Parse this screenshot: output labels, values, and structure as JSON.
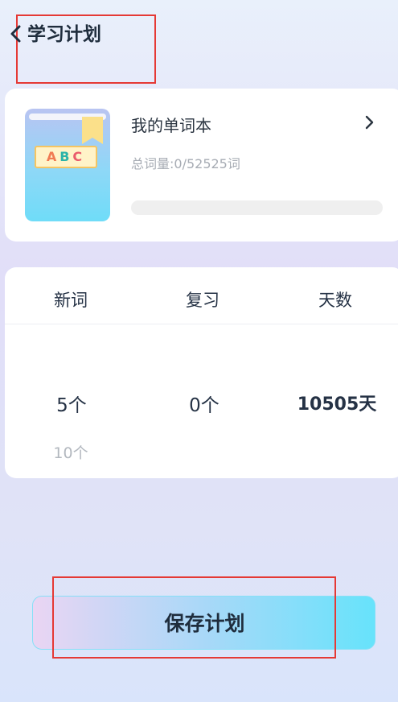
{
  "header": {
    "back_icon": "chevron-left-icon",
    "title": "学习计划"
  },
  "book": {
    "cover_letters": [
      "A",
      "B",
      "C"
    ],
    "title": "我的单词本",
    "arrow_icon": "chevron-right-icon",
    "total_words": "总词量:0/52525词",
    "progress": 0
  },
  "plan": {
    "columns": [
      {
        "header": "新词",
        "value": "5个",
        "option_below": "10个"
      },
      {
        "header": "复习",
        "value": "0个"
      },
      {
        "header": "天数",
        "value": "10505天"
      }
    ]
  },
  "save_button": {
    "label": "保存计划"
  },
  "colors": {
    "accent": "#6fdcf8",
    "highlight_border": "#e53935"
  }
}
